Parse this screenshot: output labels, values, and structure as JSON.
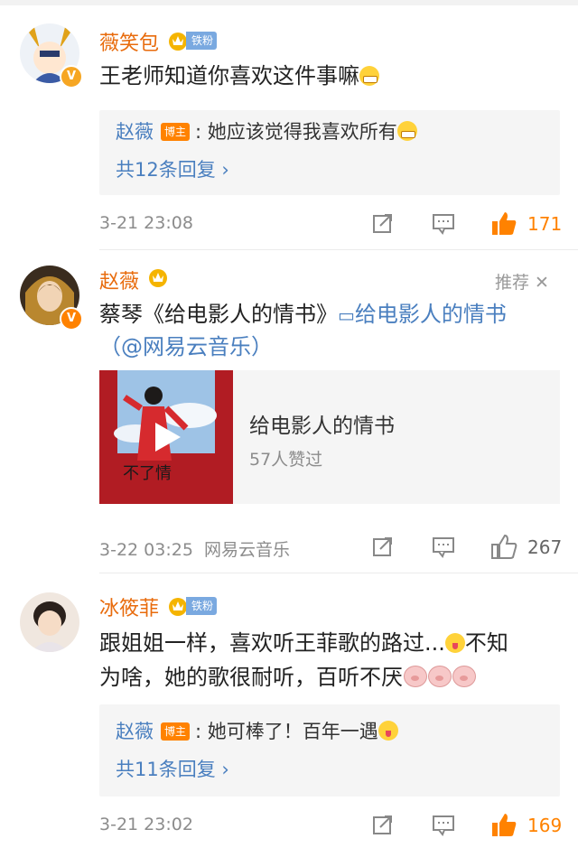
{
  "comments": [
    {
      "user": "薇笑包",
      "badge": "铁粉",
      "text": "王老师知道你喜欢这件事嘛",
      "reply": {
        "user": "赵薇",
        "tag": "博主",
        "text": ": 她应该觉得我喜欢所有",
        "more": "共12条回复 ›"
      },
      "time": "3-21 23:08",
      "likes": "171"
    },
    {
      "user": "赵薇",
      "recommend": "推荐 ✕",
      "text_line1_prefix": "蔡琴《给电影人的情书》",
      "text_line1_link": "给电影人的情书",
      "text_line2": "（@网易云音乐）",
      "card": {
        "title": "给电影人的情书",
        "subtitle": "57人赞过"
      },
      "time": "3-22 03:25  网易云音乐",
      "likes": "267"
    },
    {
      "user": "冰筱菲",
      "badge": "铁粉",
      "text_line1": "跟姐姐一样，喜欢听王菲歌的路过...",
      "text_line1_tail": "不知",
      "text_line2": "为啥，她的歌很耐听，百听不厌",
      "reply": {
        "user": "赵薇",
        "tag": "博主",
        "text": ": 她可棒了！百年一遇",
        "more": "共11条回复 ›"
      },
      "time": "3-21 23:02",
      "likes": "169"
    }
  ],
  "colors": {
    "username": "#e86b0c",
    "link": "#4a7fbf",
    "liked": "#ff8200",
    "meta": "#8c8c8c"
  },
  "icons": [
    "share-icon",
    "comment-icon",
    "like-icon"
  ]
}
